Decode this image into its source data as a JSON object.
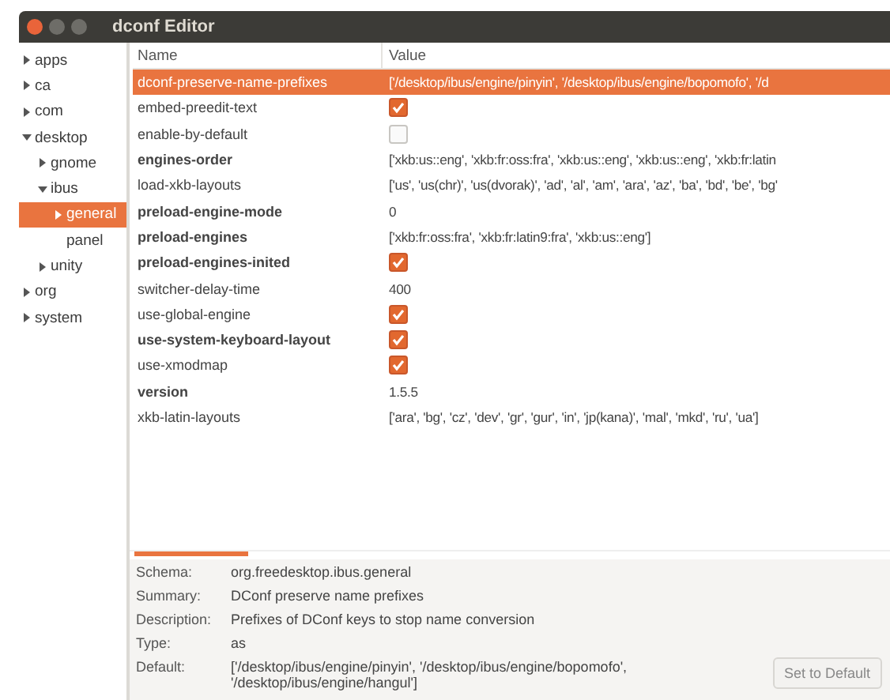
{
  "window": {
    "title": "dconf Editor"
  },
  "tree": [
    {
      "label": "apps",
      "expanded": false,
      "selected": false
    },
    {
      "label": "ca",
      "expanded": false,
      "selected": false
    },
    {
      "label": "com",
      "expanded": false,
      "selected": false
    },
    {
      "label": "desktop",
      "expanded": true,
      "selected": false,
      "children": [
        {
          "label": "gnome",
          "expanded": false,
          "selected": false
        },
        {
          "label": "ibus",
          "expanded": true,
          "selected": false,
          "children": [
            {
              "label": "general",
              "expanded": false,
              "selected": true
            },
            {
              "label": "panel",
              "selected": false
            }
          ]
        },
        {
          "label": "unity",
          "expanded": false,
          "selected": false
        }
      ]
    },
    {
      "label": "org",
      "expanded": false,
      "selected": false
    },
    {
      "label": "system",
      "expanded": false,
      "selected": false
    }
  ],
  "table": {
    "columns": [
      "Name",
      "Value"
    ],
    "rows": [
      {
        "name": "dconf-preserve-name-prefixes",
        "bold": false,
        "selected": true,
        "kind": "text",
        "value": "['/desktop/ibus/engine/pinyin', '/desktop/ibus/engine/bopomofo', '/d"
      },
      {
        "name": "embed-preedit-text",
        "bold": false,
        "selected": false,
        "kind": "check",
        "checked": true
      },
      {
        "name": "enable-by-default",
        "bold": false,
        "selected": false,
        "kind": "check",
        "checked": false
      },
      {
        "name": "engines-order",
        "bold": true,
        "selected": false,
        "kind": "text",
        "value": "['xkb:us::eng', 'xkb:fr:oss:fra', 'xkb:us::eng', 'xkb:us::eng', 'xkb:fr:latin"
      },
      {
        "name": "load-xkb-layouts",
        "bold": false,
        "selected": false,
        "kind": "text",
        "value": "['us', 'us(chr)', 'us(dvorak)', 'ad', 'al', 'am', 'ara', 'az', 'ba', 'bd', 'be', 'bg'"
      },
      {
        "name": "preload-engine-mode",
        "bold": true,
        "selected": false,
        "kind": "text",
        "value": "0"
      },
      {
        "name": "preload-engines",
        "bold": true,
        "selected": false,
        "kind": "text",
        "value": "['xkb:fr:oss:fra', 'xkb:fr:latin9:fra', 'xkb:us::eng']"
      },
      {
        "name": "preload-engines-inited",
        "bold": true,
        "selected": false,
        "kind": "check",
        "checked": true
      },
      {
        "name": "switcher-delay-time",
        "bold": false,
        "selected": false,
        "kind": "text",
        "value": "400"
      },
      {
        "name": "use-global-engine",
        "bold": false,
        "selected": false,
        "kind": "check",
        "checked": true
      },
      {
        "name": "use-system-keyboard-layout",
        "bold": true,
        "selected": false,
        "kind": "check",
        "checked": true
      },
      {
        "name": "use-xmodmap",
        "bold": false,
        "selected": false,
        "kind": "check",
        "checked": true
      },
      {
        "name": "version",
        "bold": true,
        "selected": false,
        "kind": "text",
        "value": "1.5.5"
      },
      {
        "name": "xkb-latin-layouts",
        "bold": false,
        "selected": false,
        "kind": "text",
        "value": "['ara', 'bg', 'cz', 'dev', 'gr', 'gur', 'in', 'jp(kana)', 'mal', 'mkd', 'ru', 'ua']"
      }
    ]
  },
  "details": [
    {
      "label": "Schema:",
      "value": "org.freedesktop.ibus.general"
    },
    {
      "label": "Summary:",
      "value": "DConf preserve name prefixes"
    },
    {
      "label": "Description:",
      "value": "Prefixes of DConf keys to stop name conversion"
    },
    {
      "label": "Type:",
      "value": "as"
    },
    {
      "label": "Default:",
      "value": "['/desktop/ibus/engine/pinyin', '/desktop/ibus/engine/bopomofo', '/desktop/ibus/engine/hangul']"
    }
  ],
  "button": "Set to Default"
}
